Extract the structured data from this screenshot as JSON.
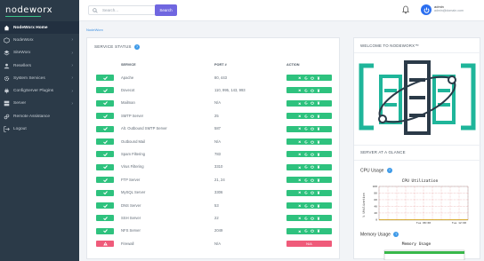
{
  "brand": {
    "logo_text": "nodeworx"
  },
  "sidebar": {
    "items": [
      {
        "label": "NodeWorx Home",
        "icon": "home-icon",
        "active": true,
        "has_chevron": false
      },
      {
        "label": "NodeWorx",
        "icon": "cube-icon",
        "active": false,
        "has_chevron": true
      },
      {
        "label": "SiteWorx",
        "icon": "layers-icon",
        "active": false,
        "has_chevron": true
      },
      {
        "label": "Resellers",
        "icon": "users-icon",
        "active": false,
        "has_chevron": true
      },
      {
        "label": "System Services",
        "icon": "gear-icon",
        "active": false,
        "has_chevron": true
      },
      {
        "label": "ConfigServer Plugins",
        "icon": "plug-icon",
        "active": false,
        "has_chevron": true
      },
      {
        "label": "Server",
        "icon": "server-icon",
        "active": false,
        "has_chevron": true
      },
      {
        "label": "Remote Assistance",
        "icon": "link-icon",
        "active": false,
        "has_chevron": false
      },
      {
        "label": "Logout",
        "icon": "logout-icon",
        "active": false,
        "has_chevron": false
      }
    ]
  },
  "topbar": {
    "search_placeholder": "Search...",
    "search_button": "Search",
    "user_name": "admin",
    "user_email": "admin@domain.com"
  },
  "breadcrumb": "NodeWorx",
  "service_status": {
    "title": "SERVICE STATUS",
    "headers": {
      "service": "SERVICE",
      "port": "PORT #",
      "action": "ACTION"
    },
    "rows": [
      {
        "name": "Apache",
        "port": "80, 443",
        "ok": true
      },
      {
        "name": "Dovecot",
        "port": "110, 995, 143, 993",
        "ok": true
      },
      {
        "name": "Mailman",
        "port": "N/A",
        "ok": true
      },
      {
        "name": "SMTP Server",
        "port": "25",
        "ok": true
      },
      {
        "name": "Alt. Outbound SMTP Server",
        "port": "587",
        "ok": true
      },
      {
        "name": "Outbound Mail",
        "port": "N/A",
        "ok": true
      },
      {
        "name": "Spam Filtering",
        "port": "783",
        "ok": true
      },
      {
        "name": "Virus Filtering",
        "port": "3310",
        "ok": true
      },
      {
        "name": "FTP Server",
        "port": "21, 24",
        "ok": true
      },
      {
        "name": "MySQL Server",
        "port": "3306",
        "ok": true
      },
      {
        "name": "DNS Server",
        "port": "53",
        "ok": true
      },
      {
        "name": "SSH Server",
        "port": "22",
        "ok": true
      },
      {
        "name": "NFS Server",
        "port": "2049",
        "ok": true
      },
      {
        "name": "Firewall",
        "port": "N/A",
        "ok": false,
        "action_label": "N/A"
      }
    ]
  },
  "welcome": {
    "title": "WELCOME TO NODEWORX™"
  },
  "glance": {
    "title": "SERVER AT A GLANCE",
    "cpu_label": "CPU Usage",
    "memory_label": "Memory Usage",
    "cpu_chart_title": "CPU Utilization",
    "cpu_ylabel": "% Utilization",
    "cpu_yticks": [
      "100",
      "80",
      "60",
      "40",
      "20",
      "0"
    ],
    "cpu_xticks": [
      "Tue 08:00",
      "Tue 12:00"
    ],
    "memory_chart_title": "Memory Usage"
  },
  "colors": {
    "ok": "#2ec27e",
    "error": "#ef5b7a",
    "sidebar": "#2b3a48",
    "accent": "#6f66e0"
  }
}
